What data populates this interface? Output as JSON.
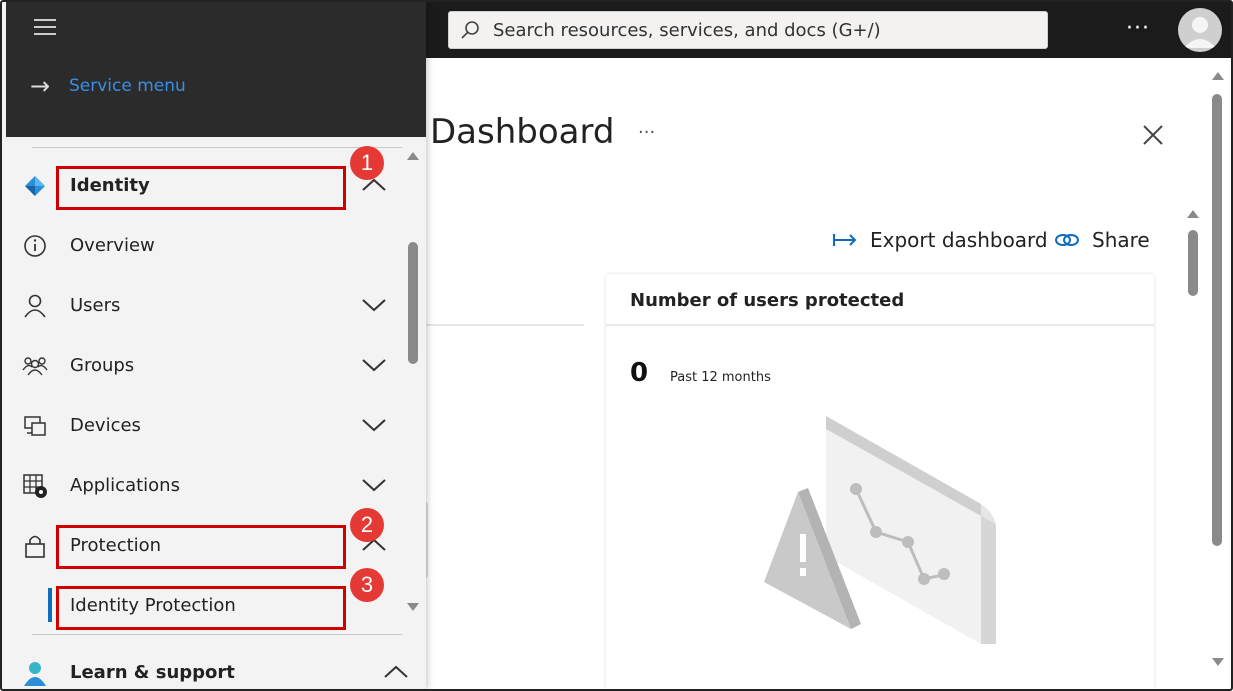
{
  "topbar": {
    "search_placeholder": "Search resources, services, and docs (G+/)",
    "more_label": "···"
  },
  "panel": {
    "service_menu_label": "Service menu",
    "items": [
      {
        "label": "Identity",
        "icon": "identity-diamond-icon",
        "chevron": "up"
      },
      {
        "label": "Overview",
        "icon": "info-icon",
        "chevron": ""
      },
      {
        "label": "Users",
        "icon": "user-icon",
        "chevron": "down"
      },
      {
        "label": "Groups",
        "icon": "groups-icon",
        "chevron": "down"
      },
      {
        "label": "Devices",
        "icon": "devices-icon",
        "chevron": "down"
      },
      {
        "label": "Applications",
        "icon": "applications-icon",
        "chevron": "down"
      },
      {
        "label": "Protection",
        "icon": "lock-icon",
        "chevron": "up"
      },
      {
        "label": "Identity Protection",
        "icon": "",
        "chevron": ""
      },
      {
        "label": "Learn & support",
        "icon": "learn-support-icon",
        "chevron": "up"
      }
    ]
  },
  "main": {
    "page_title": "Dashboard",
    "title_more": "···",
    "export_label": "Export dashboard",
    "share_label": "Share",
    "card": {
      "title": "Number of users protected",
      "value": "0",
      "period": "Past 12 months"
    }
  },
  "annotations": [
    {
      "number": "1"
    },
    {
      "number": "2"
    },
    {
      "number": "3"
    }
  ],
  "colors": {
    "accent": "#0f6cbd",
    "highlight": "#d00000",
    "badge": "#e53935",
    "link": "#3a8ee6"
  }
}
